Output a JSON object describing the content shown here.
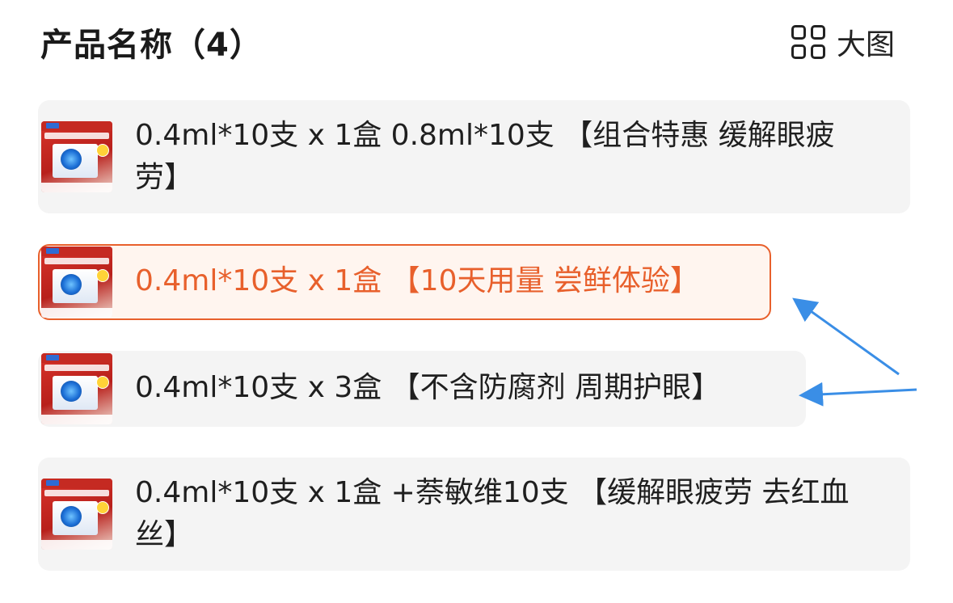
{
  "header": {
    "title": "产品名称（4）",
    "view_toggle_label": "大图"
  },
  "options": [
    {
      "label": "0.4ml*10支 x 1盒 0.8ml*10支 【组合特惠 缓解眼疲劳】",
      "selected": false,
      "thumbnail": "product-thumbnail"
    },
    {
      "label": "0.4ml*10支 x 1盒 【10天用量 尝鲜体验】",
      "selected": true,
      "thumbnail": "product-thumbnail"
    },
    {
      "label": "0.4ml*10支 x 3盒 【不含防腐剂 周期护眼】",
      "selected": false,
      "thumbnail": "product-thumbnail"
    },
    {
      "label": "0.4ml*10支 x 1盒 +萘敏维10支 【缓解眼疲劳 去红血丝】",
      "selected": false,
      "thumbnail": "product-thumbnail"
    }
  ],
  "colors": {
    "accent": "#e8602c",
    "selected_bg": "#fff5ef",
    "option_bg": "#f4f4f4",
    "annotation_arrow": "#3a8ee6"
  }
}
